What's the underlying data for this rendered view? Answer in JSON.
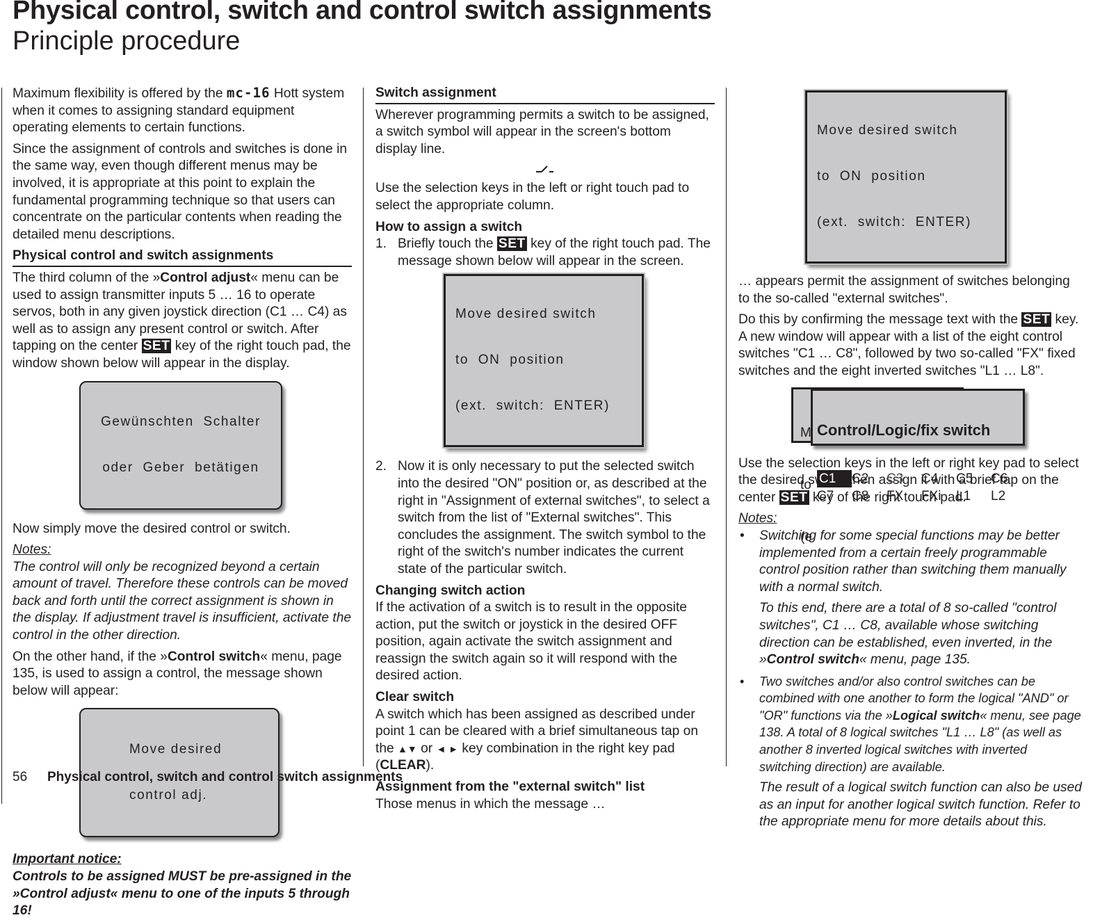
{
  "header": {
    "title": "Physical control, switch and control switch assignments",
    "subtitle": "Principle procedure"
  },
  "col1": {
    "intro_1a": "Maximum flexibility is offered by the ",
    "brand": "mc-16",
    "intro_1b": " Hott system when it comes to assigning standard equipment operating elements to certain functions.",
    "intro_2": "Since the assignment of controls and switches is done in the same way, even though different menus may be involved, it is appropriate at this point to explain the fundamental programming technique so that users can concentrate on the particular contents when reading the detailed menu descriptions.",
    "heading": "Physical control and switch assignments",
    "p1_a": "The third column of the »",
    "p1_b": "Control adjust",
    "p1_c": "« menu can be used to assign transmitter inputs 5 … 16 to operate servos, both in any given joystick direction (C1 … C4) as well as to assign any present control or switch. After tapping on the center ",
    "set_key": "SET",
    "p1_d": " key of the right touch pad, the window shown below will appear in the display.",
    "lcd1_line1": "Gewünschten  Schalter",
    "lcd1_line2": "oder  Geber  betätigen",
    "p2": "Now simply move the desired control or switch.",
    "notes_label": "Notes:",
    "notes_text": "The control will only be recognized beyond a certain amount of travel. Therefore these controls can be moved back and forth until the correct assignment is shown in the display. If adjustment travel is insufficient, activate the control in the other direction.",
    "p3_a": "On the other hand, if the »",
    "p3_b": "Control switch",
    "p3_c": "« menu, page 135, is used to assign a control, the message shown below will appear:",
    "lcd2_line1": "Move desired",
    "lcd2_line2": "control adj.",
    "important_label": "Important notice:",
    "important_text": "Controls to be assigned MUST be pre-assigned in the »Control adjust« menu to one of the inputs 5 through 16!"
  },
  "col2": {
    "heading": "Switch assignment",
    "p1": "Wherever programming permits a switch to be assigned, a switch symbol will appear in the screen's bottom display line.",
    "switch_symbol_icon": "switch-symbol-icon",
    "p2": "Use the selection keys in the left or right touch pad to select the appropriate column.",
    "how_heading": "How to assign a switch",
    "step1_num": "1.",
    "step1_a": "Briefly touch the ",
    "set_key": "SET",
    "step1_b": " key of the right touch pad. The message shown below will appear in the screen.",
    "lcd_line1": "Move desired switch",
    "lcd_line2": "to  ON  position",
    "lcd_line3": "(ext.  switch:  ENTER)",
    "step2_num": "2.",
    "step2": "Now it is only necessary to put the selected switch into the desired \"ON\" position or, as described at the right in \"Assignment of external switches\", to select a switch from the list of \"External switches\". This concludes the assignment. The switch symbol to the right of the switch's number indicates the current state of the particular switch.",
    "changing_heading": "Changing switch action",
    "changing_text": "If the activation of a switch is to result in the opposite action, put the switch or joystick in the desired OFF position, again activate the switch assignment and reassign the switch again so it will respond with the desired action.",
    "clear_heading": "Clear switch",
    "clear_a": "A switch which has been assigned as described under point 1 can be cleared with a brief simultaneous tap on the ",
    "arrows_updown": "▲▼",
    "clear_or": " or ",
    "arrows_leftright": "◄ ►",
    "clear_b": " key combination in the right key pad (",
    "clear_key": "CLEAR",
    "clear_c": ").",
    "ext_heading": "Assignment from the \"external switch\" list",
    "ext_text": "Those menus in which the message …"
  },
  "col3": {
    "lcd_line1": "Move desired switch",
    "lcd_line2": "to  ON  position",
    "lcd_line3": "(ext.  switch:  ENTER)",
    "p1": "… appears permit the assignment of switches belonging to the so-called \"external switches\".",
    "p2_a": "Do this by confirming the message text with the ",
    "set_key": "SET",
    "p2_b": " key. A new window will appear with a list of the eight control switches \"C1 … C8\", followed by two so-called \"FX\" fixed switches and the eight inverted switches \"L1 … L8\".",
    "back_lcd_line1": "M",
    "back_lcd_line2": "to",
    "back_lcd_line3": "(e",
    "popup_title": "Control/Logic/fix switch",
    "popup_items": [
      "C1",
      "C2",
      "C3",
      "C4",
      "C5",
      "C6",
      "C7",
      "C8",
      "FX",
      "FXi",
      "L1",
      "L2"
    ],
    "popup_selected": "C1",
    "p3_a": "Use the selection keys in the left or right key pad to select the desired switch then assign it with a brief tap on the center ",
    "p3_b": " key of the right touch pad.",
    "notes_label": "Notes:",
    "bullet": "•",
    "note1": "Switching for some special functions may be better implemented from a certain freely programmable control position rather than switching them manually with a normal switch.",
    "note1b_a": "To this end, there are a total of 8 so-called \"control switches\", C1 … C8, available whose switching direction can be established, even inverted, in the »",
    "note1b_b": "Control switch",
    "note1b_c": "« menu, page 135.",
    "note2_a": "Two switches and/or also control switches can be combined with one another to form the logical \"AND\" or \"OR\" functions via the »",
    "note2_b": "Logical switch",
    "note2_c": "« menu, see page 138. A total of 8 logical switches \"L1 … L8\" (as well as another 8 inverted logical switches with inverted switching direction) are available.",
    "note2b": "The result of a logical switch function can also be used as an input for another logical switch function. Refer to the appropriate menu for more details about this."
  },
  "footer": {
    "page_number": "56",
    "title": "Physical control, switch and control switch assignments"
  }
}
